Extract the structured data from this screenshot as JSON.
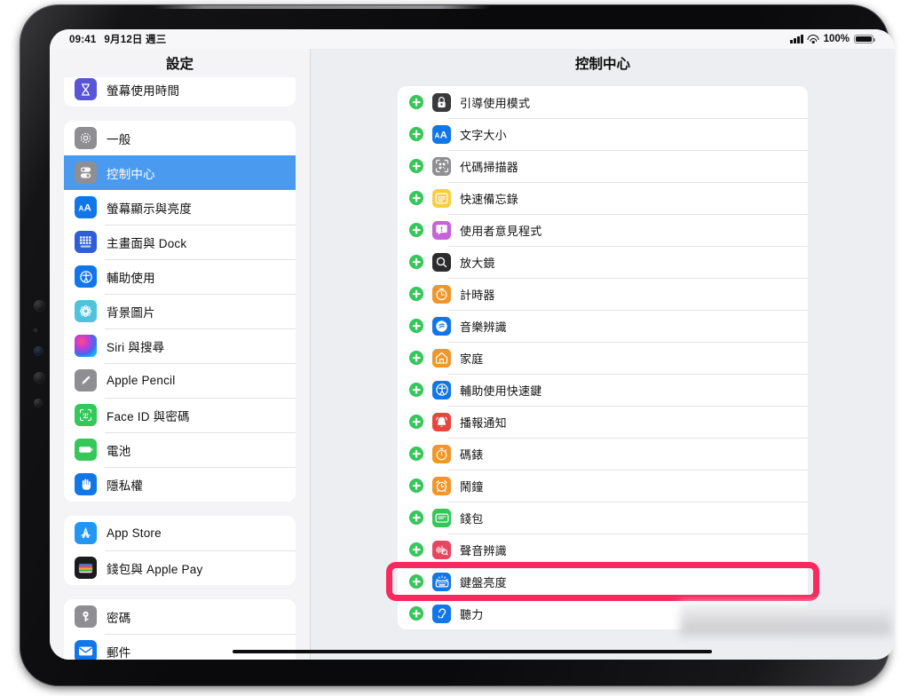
{
  "device": {
    "name": "iPad"
  },
  "status_bar": {
    "time": "09:41",
    "date": "9月12日 週三",
    "battery_percent": "100%",
    "cellular_icon": "cellular-bars-icon",
    "wifi_icon": "wifi-icon",
    "battery_icon": "battery-full-icon"
  },
  "sidebar": {
    "title": "設定",
    "groups": [
      {
        "items": [
          {
            "label": "螢幕使用時間",
            "icon": "hourglass-icon",
            "color": "#5856d6",
            "selected": false
          }
        ]
      },
      {
        "items": [
          {
            "label": "一般",
            "icon": "gear-icon",
            "color": "#8e8e93",
            "selected": false
          },
          {
            "label": "控制中心",
            "icon": "sliders-icon",
            "color": "#8e8e93",
            "selected": true
          },
          {
            "label": "螢幕顯示與亮度",
            "icon": "text-size-icon",
            "color": "#1176e8",
            "selected": false
          },
          {
            "label": "主畫面與 Dock",
            "icon": "home-screen-icon",
            "color": "#2e5fd6",
            "selected": false
          },
          {
            "label": "輔助使用",
            "icon": "accessibility-icon",
            "color": "#1176e8",
            "selected": false
          },
          {
            "label": "背景圖片",
            "icon": "wallpaper-icon",
            "color": "#4fc3dd",
            "selected": false
          },
          {
            "label": "Siri 與搜尋",
            "icon": "siri-icon",
            "color": "#1b1b2a",
            "selected": false
          },
          {
            "label": "Apple Pencil",
            "icon": "pencil-icon",
            "color": "#8e8e93",
            "selected": false
          },
          {
            "label": "Face ID 與密碼",
            "icon": "faceid-icon",
            "color": "#34c759",
            "selected": false
          },
          {
            "label": "電池",
            "icon": "battery-icon",
            "color": "#34c759",
            "selected": false
          },
          {
            "label": "隱私權",
            "icon": "privacy-hand-icon",
            "color": "#1176e8",
            "selected": false
          }
        ]
      },
      {
        "items": [
          {
            "label": "App Store",
            "icon": "appstore-icon",
            "color": "#2196f3",
            "selected": false
          },
          {
            "label": "錢包與 Apple Pay",
            "icon": "wallet-icon",
            "color": "#1b1b1d",
            "selected": false
          }
        ]
      },
      {
        "items": [
          {
            "label": "密碼",
            "icon": "key-icon",
            "color": "#8e8e93",
            "selected": false
          },
          {
            "label": "郵件",
            "icon": "mail-icon",
            "color": "#1176e8",
            "selected": false
          }
        ]
      }
    ]
  },
  "main": {
    "title": "控制中心",
    "add_icon": "plus-circle-icon",
    "items": [
      {
        "label": "引導使用模式",
        "icon": "guided-access-icon",
        "color": "#3a3a3c",
        "highlighted": false
      },
      {
        "label": "文字大小",
        "icon": "text-size-icon",
        "color": "#1176e8",
        "highlighted": false
      },
      {
        "label": "代碼掃描器",
        "icon": "qr-scanner-icon",
        "color": "#8e8e93",
        "highlighted": false
      },
      {
        "label": "快速備忘錄",
        "icon": "quick-note-icon",
        "color": "#f6cf3f",
        "highlighted": false
      },
      {
        "label": "使用者意見程式",
        "icon": "feedback-icon",
        "color": "#c563d8",
        "highlighted": false
      },
      {
        "label": "放大鏡",
        "icon": "magnifier-icon",
        "color": "#2c2c2e",
        "highlighted": false
      },
      {
        "label": "計時器",
        "icon": "timer-icon",
        "color": "#f0962a",
        "highlighted": false
      },
      {
        "label": "音樂辨識",
        "icon": "shazam-icon",
        "color": "#1176e8",
        "highlighted": false
      },
      {
        "label": "家庭",
        "icon": "home-icon",
        "color": "#f0962a",
        "highlighted": false
      },
      {
        "label": "輔助使用快速鍵",
        "icon": "accessibility-icon",
        "color": "#1176e8",
        "highlighted": false
      },
      {
        "label": "播報通知",
        "icon": "announce-bell-icon",
        "color": "#e8453c",
        "highlighted": false
      },
      {
        "label": "碼錶",
        "icon": "stopwatch-icon",
        "color": "#f0962a",
        "highlighted": false
      },
      {
        "label": "鬧鐘",
        "icon": "alarm-clock-icon",
        "color": "#f0962a",
        "highlighted": false
      },
      {
        "label": "錢包",
        "icon": "wallet-card-icon",
        "color": "#34c759",
        "highlighted": false
      },
      {
        "label": "聲音辨識",
        "icon": "sound-recognition-icon",
        "color": "#e8455f",
        "highlighted": false
      },
      {
        "label": "鍵盤亮度",
        "icon": "keyboard-brightness-icon",
        "color": "#1176e8",
        "highlighted": true
      },
      {
        "label": "聽力",
        "icon": "hearing-icon",
        "color": "#1176e8",
        "highlighted": false
      }
    ]
  },
  "callout": {
    "color": "#f8295f",
    "target_label": "鍵盤亮度"
  },
  "colors": {
    "accent_blue": "#4a9bf0",
    "highlight_pink": "#f8295f",
    "add_green": "#34c759",
    "bg_grey": "#eceef2",
    "card_white": "#ffffff"
  }
}
